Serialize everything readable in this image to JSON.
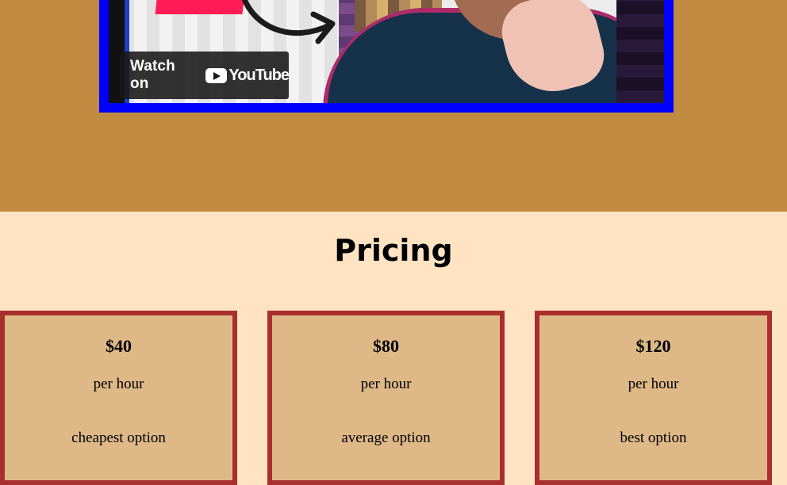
{
  "video": {
    "watch_label": "Watch on",
    "platform_label": "YouTube",
    "thumbnail_icon": "video-thumbnail"
  },
  "pricing": {
    "title": "Pricing",
    "plans": [
      {
        "price": "$40",
        "unit": "per hour",
        "label": "cheapest option"
      },
      {
        "price": "$80",
        "unit": "per hour",
        "label": "average option"
      },
      {
        "price": "$120",
        "unit": "per hour",
        "label": "best option"
      }
    ]
  },
  "colors": {
    "top_band": "#c08a40",
    "page_bg": "#ffe3c3",
    "video_border": "#0000ff",
    "card_bg": "#deb887",
    "card_border": "#a82f2d"
  }
}
